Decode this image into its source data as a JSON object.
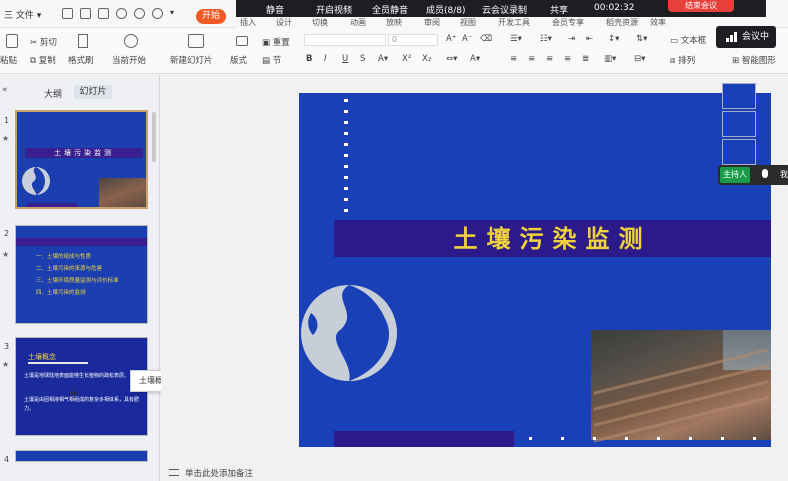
{
  "app": {
    "file_menu": "三 文件 ▾",
    "start_button": "开始"
  },
  "meeting_bar": {
    "items": [
      "静音",
      "开启视频",
      "全员静音",
      "成员(8/8)",
      "云会议录制",
      "共享"
    ],
    "timer": "00:02:32",
    "end": "结束会议",
    "badge": "会议中"
  },
  "ribbon_tabs": [
    "插入",
    "设计",
    "切换",
    "动画",
    "放映",
    "审阅",
    "视图",
    "开发工具",
    "会员专享",
    "稻壳资源",
    "效率"
  ],
  "ribbon": {
    "paste": "粘贴",
    "cut": "剪切",
    "copy": "复制",
    "format_painter": "格式刷",
    "play_from_current": "当前开始",
    "new_slide": "新建幻灯片",
    "layout": "版式",
    "section": "节",
    "reset": "重置",
    "font_size_placeholder": "0",
    "text_box": "文本框",
    "arrange": "排列",
    "smart_shape": "智能图形"
  },
  "left_panel": {
    "outline_tab": "大纲",
    "slides_tab": "幻灯片",
    "slide_numbers": [
      "1",
      "2",
      "3",
      "4"
    ],
    "tooltip": "土壤概念"
  },
  "thumbnails": {
    "slide1_title": "土壤污染监测",
    "slide2_items": [
      "一、土壤的组成与性质",
      "二、土壤污染的来源与危害",
      "三、土壤环境质量监测与评价标准",
      "四、土壤污染的监测"
    ],
    "slide3_heading": "土壤概念",
    "slide3_bullets": [
      "土壤是地球陆地表面能够生长植物的疏松表层。",
      "土壤是由固相液相气相组成的复杂多相体系，具有肥力。"
    ]
  },
  "slide": {
    "title": "土壤污染监测"
  },
  "participant": {
    "host_label": "主持人",
    "more": "我"
  },
  "status_bar": {
    "notes": "单击此处添加备注"
  }
}
